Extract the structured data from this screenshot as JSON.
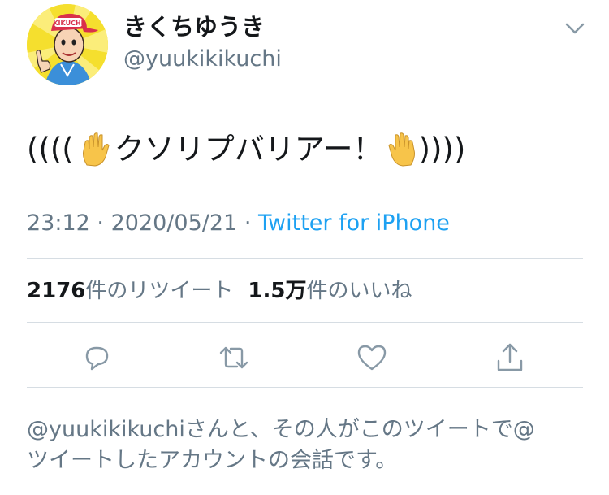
{
  "author": {
    "display_name": "きくちゆうき",
    "handle": "@yuukikikuchi",
    "avatar_cap_text": "KIKUCHI"
  },
  "tweet": {
    "prefix": "((((",
    "body": "クソリプバリアー！",
    "suffix": "))))",
    "emoji": "raised-hand"
  },
  "meta": {
    "time": "23:12",
    "separator": "·",
    "date": "2020/05/21",
    "source": "Twitter for iPhone"
  },
  "stats": {
    "retweets_count": "2176",
    "retweets_label": "件のリツイート",
    "likes_count": "1.5万",
    "likes_label": "件のいいね"
  },
  "actions": [
    {
      "icon": "reply-icon"
    },
    {
      "icon": "retweet-icon"
    },
    {
      "icon": "like-icon"
    },
    {
      "icon": "share-icon"
    }
  ],
  "footer": {
    "context_line1": "@yuukikikuchiさんと、その人がこのツイートで@",
    "context_line2": "ツイートしたアカウントの会話です。"
  },
  "colors": {
    "text": "#14171a",
    "secondary": "#657786",
    "link": "#1da1f2",
    "divider": "#d6dde3"
  }
}
